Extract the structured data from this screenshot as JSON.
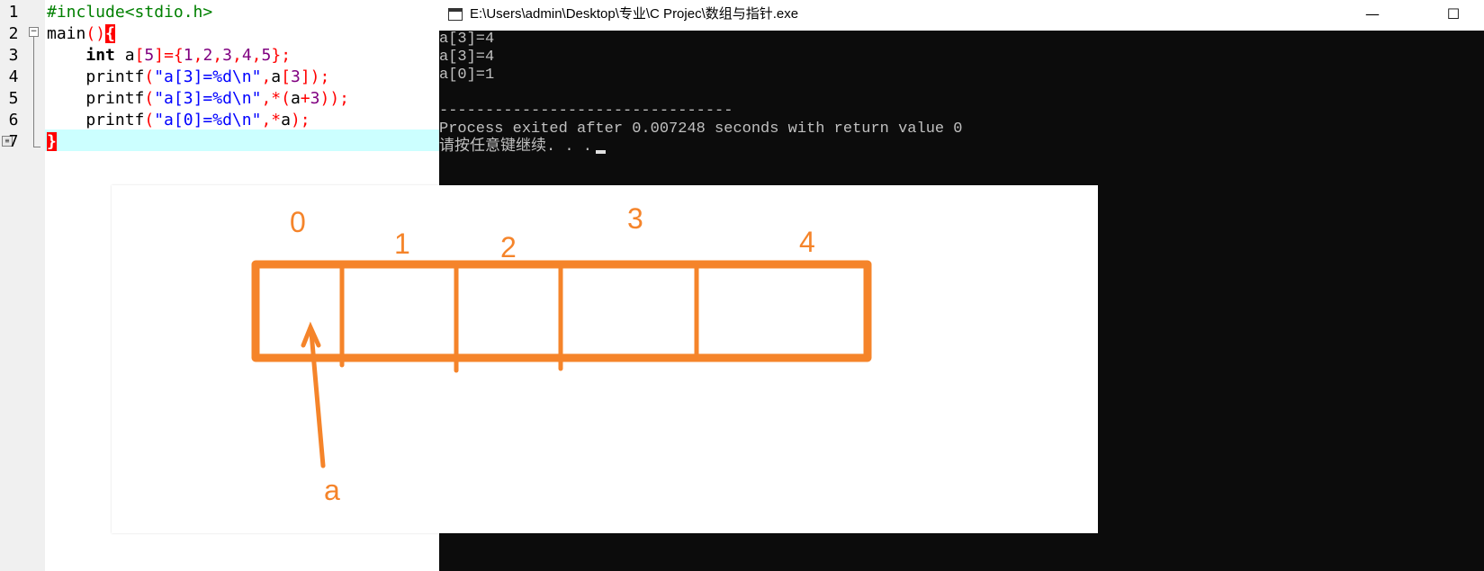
{
  "editor": {
    "line_numbers": [
      "1",
      "2",
      "3",
      "4",
      "5",
      "6",
      "7"
    ],
    "lines": [
      [
        {
          "t": "#include<stdio.h>",
          "c": "tok-green"
        }
      ],
      [
        {
          "t": "main",
          "c": ""
        },
        {
          "t": "()",
          "c": "tok-red"
        },
        {
          "t": "{",
          "c": "brace-hl"
        }
      ],
      [
        {
          "t": "    ",
          "c": ""
        },
        {
          "t": "int",
          "c": "tok-bold"
        },
        {
          "t": " a",
          "c": ""
        },
        {
          "t": "[",
          "c": "tok-red"
        },
        {
          "t": "5",
          "c": "tok-purple"
        },
        {
          "t": "]={",
          "c": "tok-red"
        },
        {
          "t": "1",
          "c": "tok-purple"
        },
        {
          "t": ",",
          "c": "tok-red"
        },
        {
          "t": "2",
          "c": "tok-purple"
        },
        {
          "t": ",",
          "c": "tok-red"
        },
        {
          "t": "3",
          "c": "tok-purple"
        },
        {
          "t": ",",
          "c": "tok-red"
        },
        {
          "t": "4",
          "c": "tok-purple"
        },
        {
          "t": ",",
          "c": "tok-red"
        },
        {
          "t": "5",
          "c": "tok-purple"
        },
        {
          "t": "};",
          "c": "tok-red"
        }
      ],
      [
        {
          "t": "    printf",
          "c": ""
        },
        {
          "t": "(",
          "c": "tok-red"
        },
        {
          "t": "\"a[3]=%d\\n\"",
          "c": "tok-blue"
        },
        {
          "t": ",",
          "c": "tok-red"
        },
        {
          "t": "a",
          "c": ""
        },
        {
          "t": "[",
          "c": "tok-red"
        },
        {
          "t": "3",
          "c": "tok-purple"
        },
        {
          "t": "]);",
          "c": "tok-red"
        }
      ],
      [
        {
          "t": "    printf",
          "c": ""
        },
        {
          "t": "(",
          "c": "tok-red"
        },
        {
          "t": "\"a[3]=%d\\n\"",
          "c": "tok-blue"
        },
        {
          "t": ",*(",
          "c": "tok-red"
        },
        {
          "t": "a",
          "c": ""
        },
        {
          "t": "+",
          "c": "tok-red"
        },
        {
          "t": "3",
          "c": "tok-purple"
        },
        {
          "t": "));",
          "c": "tok-red"
        }
      ],
      [
        {
          "t": "    printf",
          "c": ""
        },
        {
          "t": "(",
          "c": "tok-red"
        },
        {
          "t": "\"a[0]=%d\\n\"",
          "c": "tok-blue"
        },
        {
          "t": ",*",
          "c": "tok-red"
        },
        {
          "t": "a",
          "c": ""
        },
        {
          "t": ");",
          "c": "tok-red"
        }
      ],
      [
        {
          "t": "}",
          "c": "brace-hl"
        }
      ]
    ],
    "fold_symbol": "−",
    "bookmark_symbol": "≡"
  },
  "console": {
    "title": "E:\\Users\\admin\\Desktop\\专业\\C Projec\\数组与指针.exe",
    "minimize_symbol": "—",
    "maximize_symbol": "☐",
    "output_lines": [
      "a[3]=4",
      "a[3]=4",
      "a[0]=1",
      "",
      "--------------------------------",
      "Process exited after 0.007248 seconds with return value 0",
      "请按任意键继续. . ."
    ]
  },
  "diagram": {
    "indices": [
      "0",
      "1",
      "2",
      "3",
      "4"
    ],
    "pointer_label": "a",
    "stroke_color": "#f5842a"
  }
}
